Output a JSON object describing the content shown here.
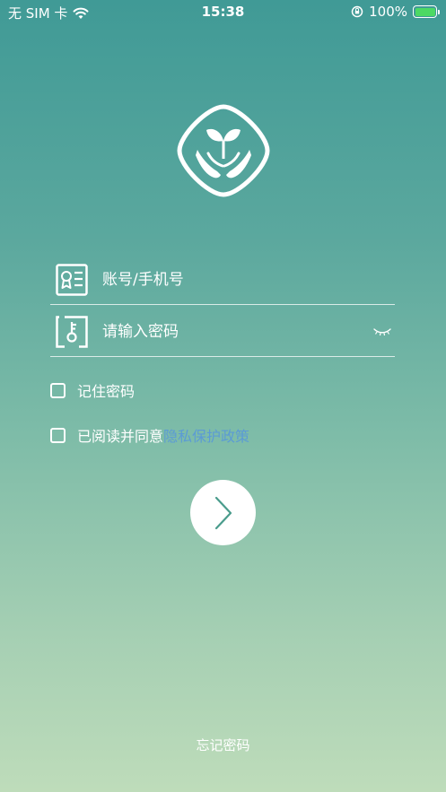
{
  "status_bar": {
    "carrier": "无 SIM 卡",
    "time": "15:38",
    "battery_percent": "100%"
  },
  "login": {
    "account_placeholder": "账号/手机号",
    "password_placeholder": "请输入密码",
    "remember_password": "记住密码",
    "agree_prefix": "已阅读并同意",
    "privacy_policy_link": "隐私保护政策",
    "forgot_password": "忘记密码"
  },
  "colors": {
    "gradient_top": "#409a96",
    "gradient_bottom": "#bedcba",
    "link": "#5b9bd5",
    "arrow": "#4a9c8c"
  },
  "icons": [
    "wifi-icon",
    "rotation-lock-icon",
    "battery-icon",
    "app-logo",
    "id-card-icon",
    "key-icon",
    "eye-closed-icon",
    "chevron-right-icon"
  ]
}
